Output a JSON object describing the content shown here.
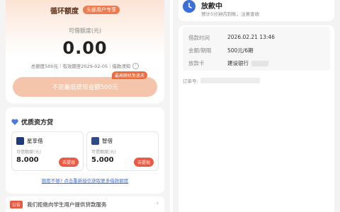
{
  "credit": {
    "header_title": "循环额度",
    "header_tag": "头部用户专享",
    "available_label": "可借额度(元)",
    "available_amount": "0.00",
    "total_label": "总额度500元",
    "validity": "有效期至2029-02-05",
    "notice_link": "借款须知",
    "coupon_tag": "最高随机免息天",
    "withdraw_button": "不足最低提现金额500元"
  },
  "lenders": {
    "title": "优质资方贷",
    "items": [
      {
        "name": "星享借",
        "sub_label": "可借额度(元)",
        "amount": "8.000",
        "button": "去提现"
      },
      {
        "name": "智借",
        "sub_label": "可借额度(元)",
        "amount": "5.000",
        "button": "去提现"
      }
    ],
    "more_link": "额度不够? 点击重新授信获取更多借款额度"
  },
  "notice": {
    "badge": "公告",
    "text": "我们拒绝向学生用户提供贷款服务"
  },
  "loan_status": {
    "title": "放款中",
    "description": "预计5分钟内到账，注意查收",
    "rows": [
      {
        "label": "借款时间",
        "value": "2026.02.21 13:46"
      },
      {
        "label": "金额/期限",
        "value": "500元/6期"
      },
      {
        "label": "放款卡",
        "value": "建设银行"
      }
    ],
    "order_label": "订单号:"
  },
  "colors": {
    "accent": "#ea5a45",
    "withdraw_disabled": "#f5c5ab",
    "link": "#3f6fd8",
    "status_icon": "#3a6fd8"
  },
  "icons": {
    "status": "clock-icon",
    "lenders_title": "heart-icon",
    "info": "info-icon",
    "notice_arrow": "chevron-right-icon"
  }
}
